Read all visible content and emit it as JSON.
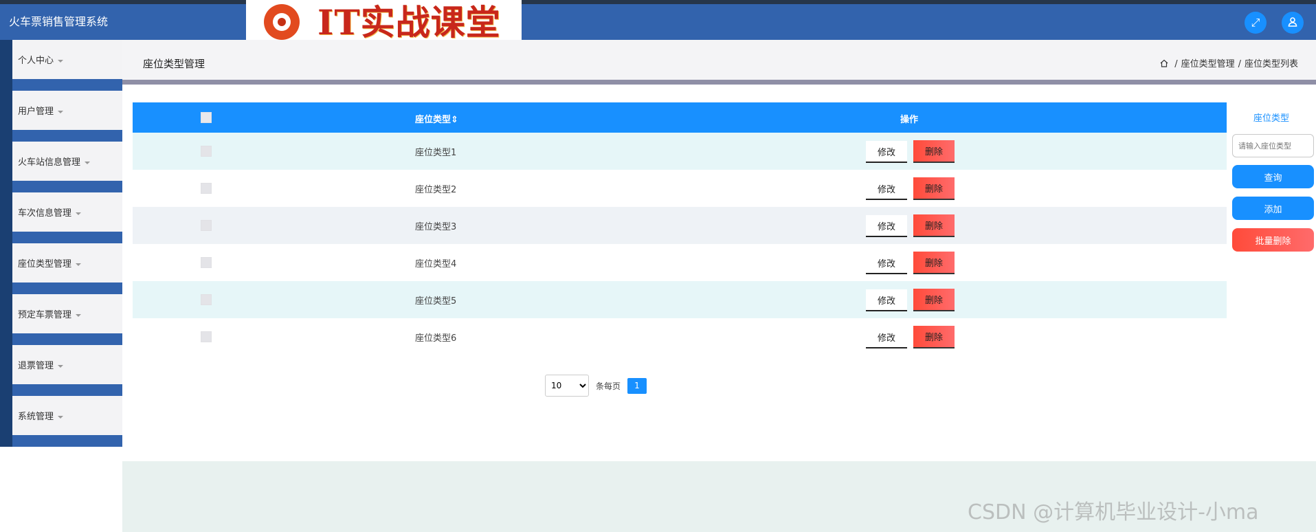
{
  "header": {
    "app_title": "火车票销售管理系统",
    "logo_text": "IT实战课堂",
    "icons": [
      "expand-icon",
      "user-icon"
    ]
  },
  "sidebar": {
    "items": [
      {
        "label": "个人中心"
      },
      {
        "label": "用户管理"
      },
      {
        "label": "火车站信息管理"
      },
      {
        "label": "车次信息管理"
      },
      {
        "label": "座位类型管理"
      },
      {
        "label": "预定车票管理"
      },
      {
        "label": "退票管理"
      },
      {
        "label": "系统管理"
      }
    ]
  },
  "page": {
    "title": "座位类型管理",
    "breadcrumb": [
      "座位类型管理",
      "座位类型列表"
    ]
  },
  "table": {
    "columns": {
      "name": "座位类型",
      "sort_icon": "⇕",
      "operation": "操作"
    },
    "rows": [
      {
        "name": "座位类型1"
      },
      {
        "name": "座位类型2"
      },
      {
        "name": "座位类型3"
      },
      {
        "name": "座位类型4"
      },
      {
        "name": "座位类型5"
      },
      {
        "name": "座位类型6"
      }
    ],
    "edit_label": "修改",
    "delete_label": "删除"
  },
  "pagination": {
    "page_size": "10",
    "per_page_label": "条每页",
    "current_page": "1"
  },
  "search_panel": {
    "label": "座位类型",
    "placeholder": "请输入座位类型",
    "query_label": "查询",
    "add_label": "添加",
    "batch_delete_label": "批量删除"
  },
  "watermark": "CSDN @计算机毕业设计-小ma",
  "colors": {
    "primary": "#1890ff",
    "header": "#3263ad",
    "danger": "#ff4b3a"
  }
}
